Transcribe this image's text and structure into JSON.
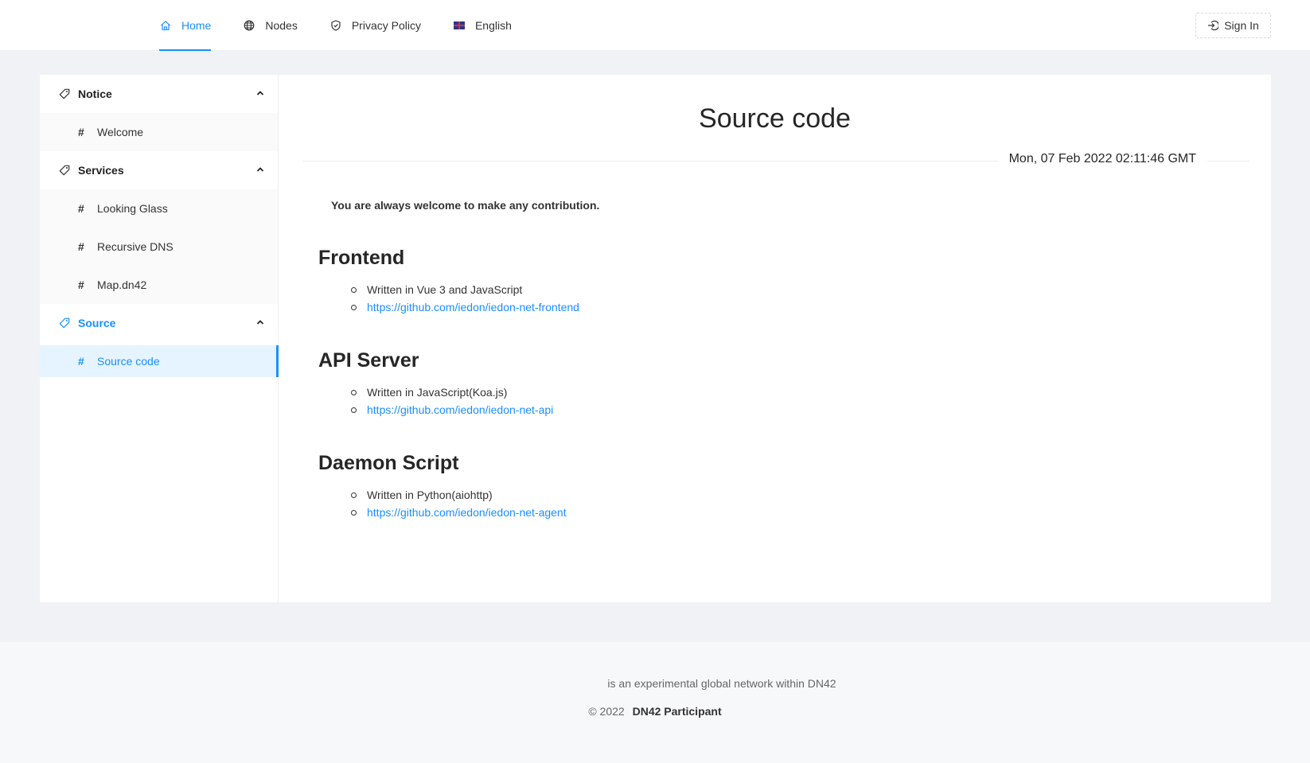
{
  "nav": {
    "items": [
      {
        "label": "Home",
        "icon": "home-icon",
        "active": true
      },
      {
        "label": "Nodes",
        "icon": "globe-icon"
      },
      {
        "label": "Privacy Policy",
        "icon": "shield-icon"
      },
      {
        "label": "English",
        "icon": "uk-flag-icon"
      }
    ],
    "signin_label": "Sign In"
  },
  "sidebar": {
    "groups": [
      {
        "label": "Notice",
        "items": [
          {
            "label": "Welcome"
          }
        ]
      },
      {
        "label": "Services",
        "items": [
          {
            "label": "Looking Glass"
          },
          {
            "label": "Recursive DNS"
          },
          {
            "label": "Map.dn42"
          }
        ]
      },
      {
        "label": "Source",
        "active": true,
        "items": [
          {
            "label": "Source code",
            "active": true
          }
        ]
      }
    ],
    "hash_symbol": "#"
  },
  "article": {
    "title": "Source code",
    "date": "Mon, 07 Feb 2022 02:11:46 GMT",
    "intro": "You are always welcome to make any contribution.",
    "sections": [
      {
        "heading": "Frontend",
        "desc": "Written in Vue 3 and JavaScript",
        "link": "https://github.com/iedon/iedon-net-frontend"
      },
      {
        "heading": "API Server",
        "desc": "Written in JavaScript(Koa.js)",
        "link": "https://github.com/iedon/iedon-net-api"
      },
      {
        "heading": "Daemon Script",
        "desc": "Written in Python(aiohttp)",
        "link": "https://github.com/iedon/iedon-net-agent"
      }
    ]
  },
  "footer": {
    "tagline": "is an experimental global network within DN42",
    "copyright": "© 2022",
    "owner": "DN42 Participant"
  },
  "colors": {
    "accent": "#1890ff",
    "background": "#f0f2f5"
  }
}
